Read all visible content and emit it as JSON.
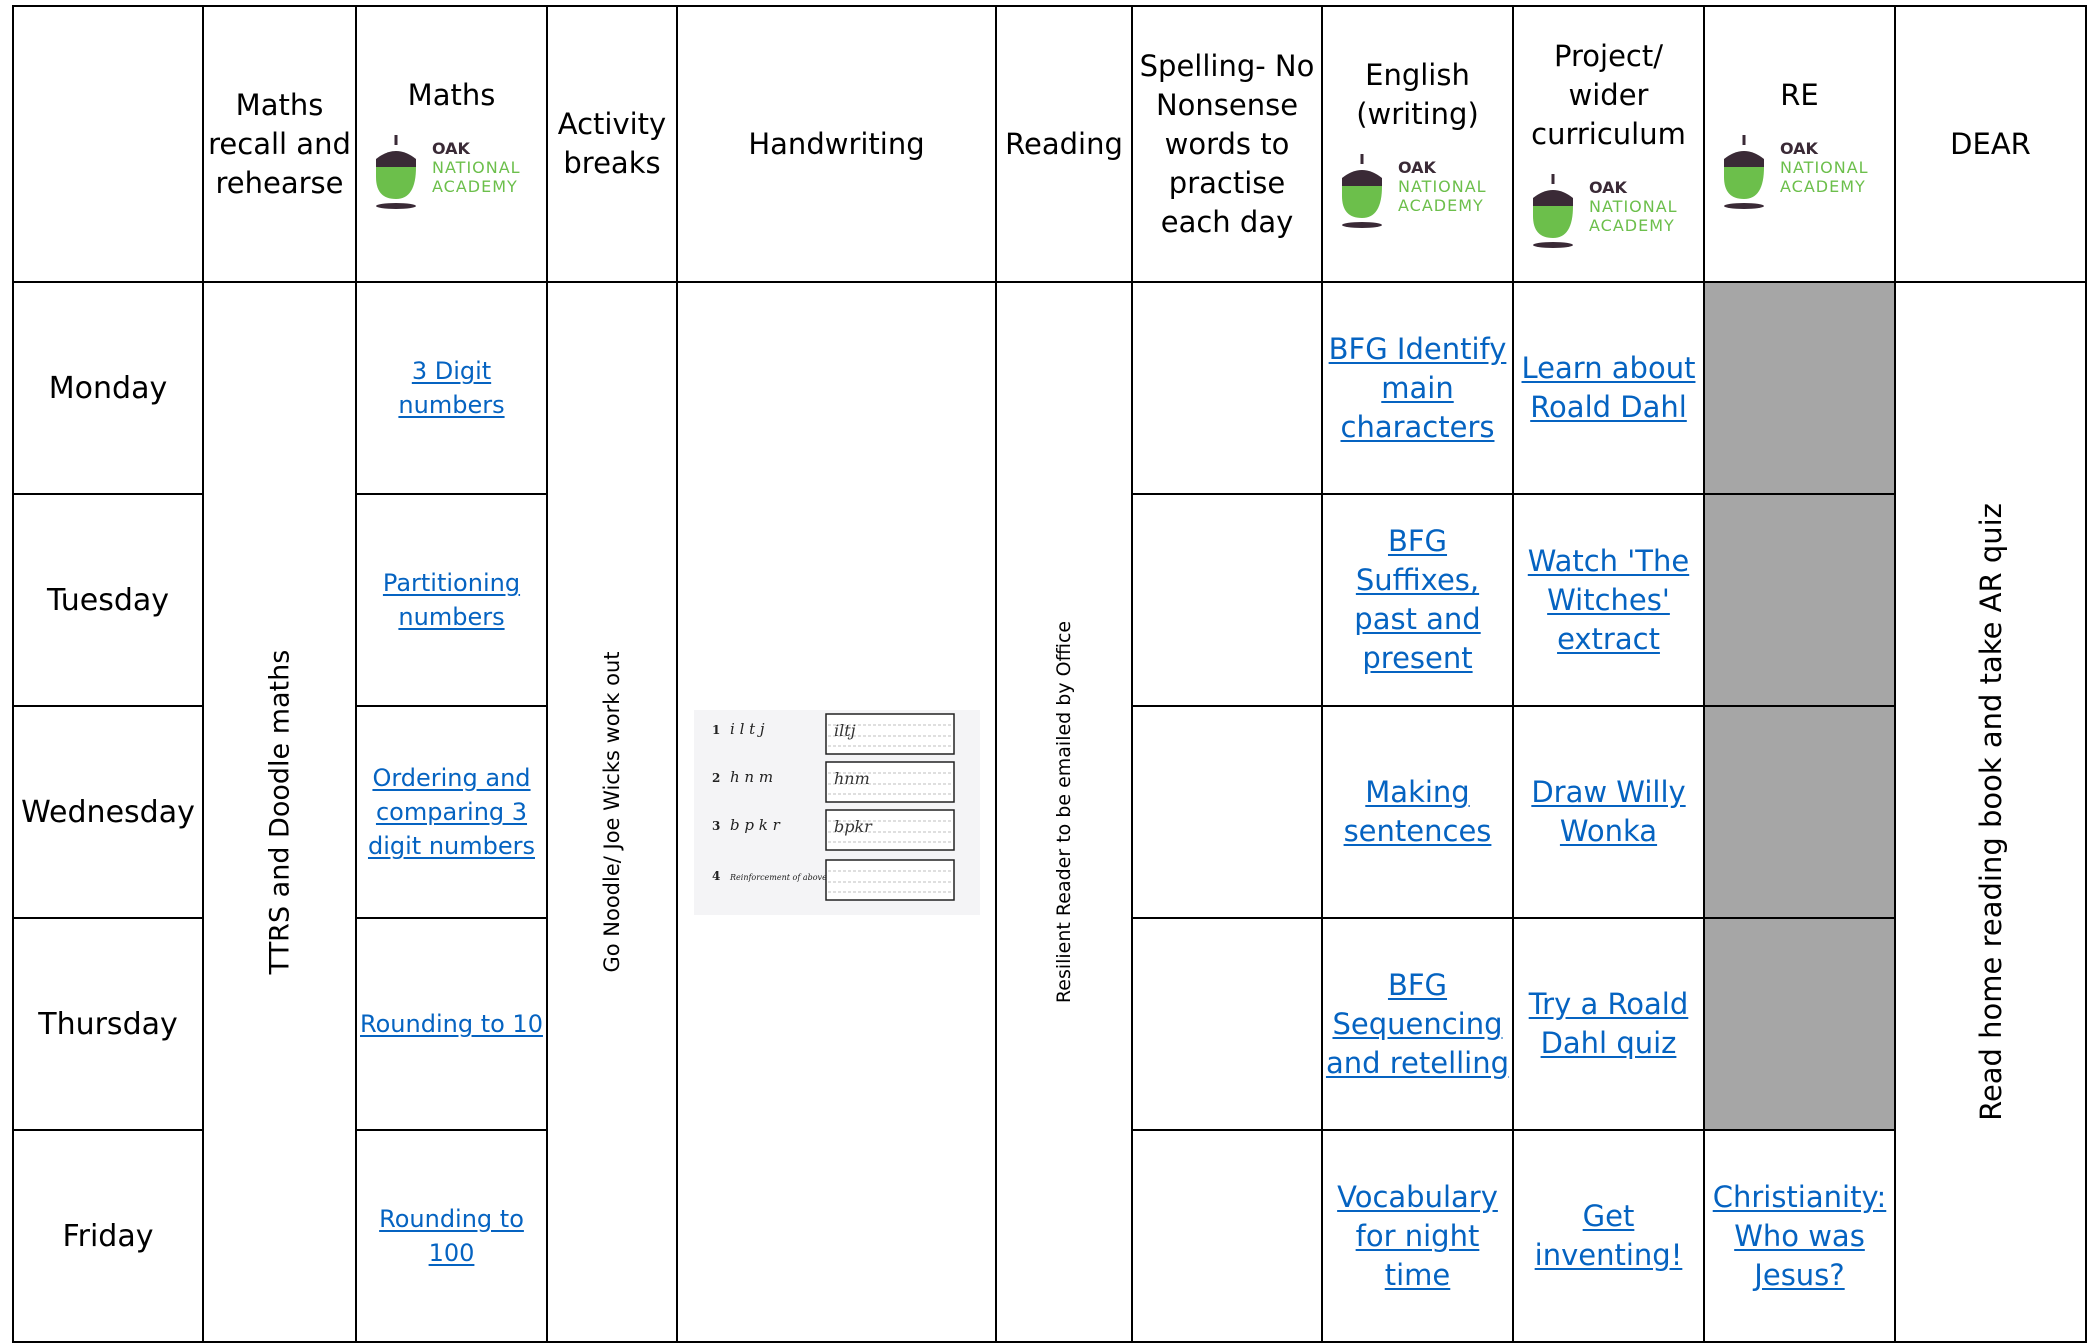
{
  "headers": {
    "maths_recall": "Maths recall and rehearse",
    "maths": "Maths",
    "activity": "Activity breaks",
    "handwriting": "Handwriting",
    "reading": "Reading",
    "spelling": "Spelling- No Nonsense words to practise each day",
    "english": "English (writing)",
    "project": "Project/ wider curriculum",
    "re": "RE",
    "dear": "DEAR"
  },
  "oak_logo": {
    "line1": "OAK",
    "line2": "NATIONAL",
    "line3": "ACADEMY",
    "colors": {
      "text_dark": "#3a2a36",
      "text_green": "#6cbf4b",
      "acorn_cap": "#3a2a36",
      "acorn_body": "#6cbf4b"
    }
  },
  "days": [
    "Monday",
    "Tuesday",
    "Wednesday",
    "Thursday",
    "Friday"
  ],
  "spanning": {
    "maths_recall": "TTRS and Doodle maths",
    "activity": "Go Noodle/ Joe Wicks work out",
    "reading": "Resilient Reader to be emailed by Office",
    "dear": "Read home reading book and take AR quiz"
  },
  "maths_links": [
    "3 Digit numbers",
    "Partitioning numbers",
    "Ordering and comparing 3 digit numbers",
    "Rounding to 10",
    "Rounding to 100"
  ],
  "english_links": [
    "BFG Identify main characters",
    "BFG Suffixes, past and present",
    "Making sentences",
    "BFG Sequencing and retelling",
    "Vocabulary for night time"
  ],
  "project_links": [
    "Learn about Roald Dahl",
    "Watch 'The Witches' extract",
    "Draw Willy Wonka",
    "Try a Roald Dahl quiz",
    "Get inventing!"
  ],
  "re_links": [
    "Christianity: Who was Jesus?"
  ],
  "handwriting_sheet": {
    "rows": [
      {
        "num": "1",
        "letters": "i l t j",
        "traced": "iltj"
      },
      {
        "num": "2",
        "letters": "h n m",
        "traced": "hnm"
      },
      {
        "num": "3",
        "letters": "b p k r",
        "traced": "bpkr"
      },
      {
        "num": "4",
        "letters": "Reinforcement of above",
        "traced": ""
      }
    ]
  },
  "colors": {
    "link": "#0563c1",
    "grey_cell": "#a6a6a6",
    "border": "#000000"
  }
}
